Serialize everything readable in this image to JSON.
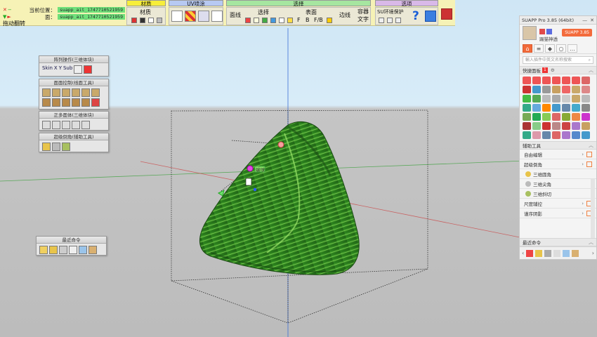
{
  "toolbar": {
    "position_label": "当前位置：",
    "position_value": "suapp_ait_1747710521959",
    "face_label": "面：",
    "face_value": "suapp_ait_1747710521959",
    "drag_label": "拖动翻转",
    "groups": {
      "material_header": "材质",
      "uv_header": "UV喷涂",
      "select_header": "选择",
      "options_header": "选项"
    },
    "material_label": "材质",
    "face_line_label": "面线",
    "select_label": "选择",
    "surface_label": "表面",
    "edge_label": "边线",
    "container_label": "容器",
    "text_label": "文字",
    "env_protect_label": "SU环境保护",
    "fb_labels": [
      "F",
      "B",
      "F/B"
    ],
    "help_glyph": "?",
    "colors": {
      "bg": "#f6f2b6",
      "material_header": "#f7ee3a",
      "uv_header": "#b7c9f2",
      "select_header": "#a6e6a0",
      "options_header": "#d9b9e8"
    }
  },
  "panels": {
    "array": {
      "title": "阵列操作(三维体块)",
      "items": [
        "Skin",
        "X",
        "Y",
        "Sub"
      ]
    },
    "surface_ops": {
      "title": "面面控制(线面工具)"
    },
    "basic_solid": {
      "title": "正多面体(三维体块)"
    },
    "super_fillet": {
      "title": "超级倒角(辅助工具)"
    },
    "recent": {
      "title": "最近命令"
    }
  },
  "scene": {
    "tag_label": "端球"
  },
  "suapp": {
    "window_title": "SUAPP Pro 3.85 (64bit)",
    "upgrade_label": "SUAPP 3.85",
    "username": "踢猫神透",
    "search_placeholder": "輸入插件中英文名称搜索",
    "quick_panel_label": "快捷面板",
    "quick_panel_count": "1",
    "aux_tools_label": "辅助工具",
    "list": [
      {
        "label": "自由编辑"
      },
      {
        "label": "超级倒角"
      }
    ],
    "sub_items": [
      "三维圆角",
      "三维尖角",
      "三维斜切"
    ],
    "more_items": [
      "尺度辅控",
      "谨序阴影"
    ],
    "recent_label": "最近命令",
    "accent": "#f26a3a"
  }
}
